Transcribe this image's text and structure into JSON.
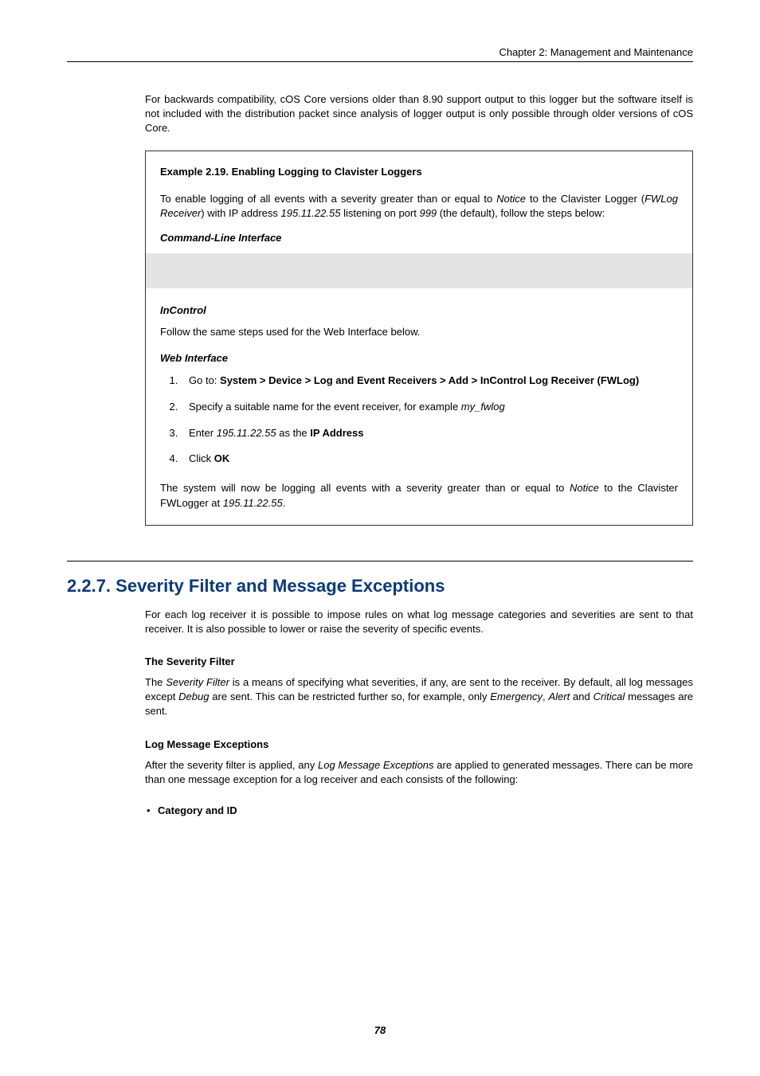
{
  "header": {
    "chapter": "Chapter 2: Management and Maintenance"
  },
  "intro": "For backwards compatibility, cOS Core versions older than 8.90 support output to this logger but the software itself is not included with the distribution packet since analysis of logger output is only possible through older versions of cOS Core.",
  "example": {
    "title": "Example 2.19. Enabling Logging to Clavister Loggers",
    "para_pre": "To enable logging of all events with a severity greater than or equal to ",
    "para_notice": "Notice",
    "para_mid1": " to the Clavister Logger (",
    "para_fwlog": "FWLog Receiver",
    "para_mid2": ") with IP address ",
    "para_ip": "195.11.22.55",
    "para_mid3": " listening on port ",
    "para_port": "999",
    "para_post": " (the default), follow the steps below:",
    "cli_head": "Command-Line Interface",
    "incontrol_head": "InControl",
    "incontrol_text": "Follow the same steps used for the Web Interface below.",
    "web_head": "Web Interface",
    "step1_pre": "Go to: ",
    "step1_bold": "System > Device > Log and Event Receivers > Add > InControl Log Receiver (FWLog)",
    "step2_pre": "Specify a suitable name for the event receiver, for example ",
    "step2_em": "my_fwlog",
    "step3_pre": "Enter ",
    "step3_em": "195.11.22.55",
    "step3_mid": " as the ",
    "step3_bold": "IP Address",
    "step4_pre": "Click ",
    "step4_bold": "OK",
    "closing_pre": "The system will now be logging all events with a severity greater than or equal to ",
    "closing_notice": "Notice",
    "closing_mid": " to the Clavister FWLogger at ",
    "closing_ip": "195.11.22.55",
    "closing_post": "."
  },
  "section": {
    "heading": "2.2.7. Severity Filter and Message Exceptions",
    "intro": "For each log receiver it is possible to impose rules on what log message categories and severities are sent to that receiver. It is also possible to lower or raise the severity of specific events.",
    "sev_head": "The Severity Filter",
    "sev_pre": "The ",
    "sev_em1": "Severity Filter",
    "sev_mid1": " is a means of specifying what severities, if any, are sent to the receiver. By default, all log messages except ",
    "sev_em2": "Debug",
    "sev_mid2": " are sent. This can be restricted further so, for example, only ",
    "sev_em3": "Emergency",
    "sev_comma": ", ",
    "sev_em4": "Alert",
    "sev_and": " and ",
    "sev_em5": "Critical",
    "sev_post": " messages are sent.",
    "lme_head": "Log Message Exceptions",
    "lme_pre": "After the severity filter is applied, any ",
    "lme_em": "Log Message Exceptions",
    "lme_post": " are applied to generated messages. There can be more than one message exception for a log receiver and each consists of the following:",
    "bullet1": "Category and ID"
  },
  "page_number": "78"
}
